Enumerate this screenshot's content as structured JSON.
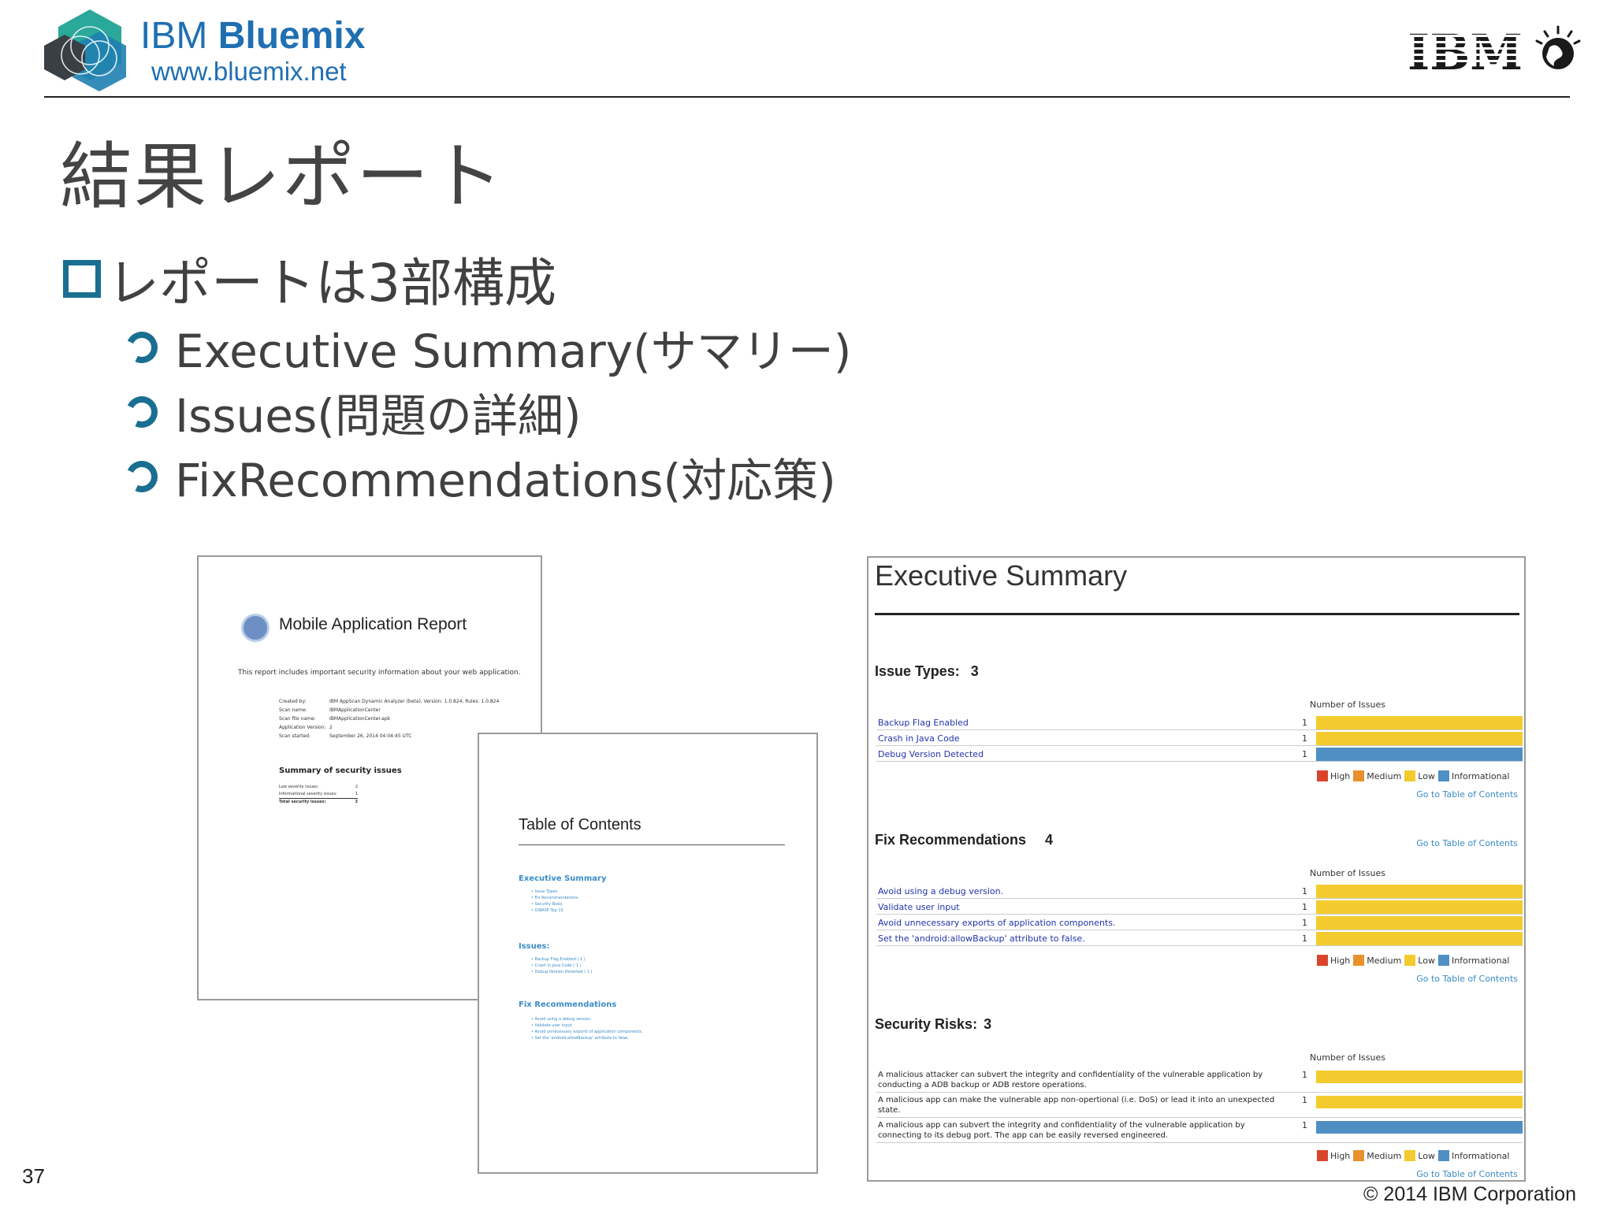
{
  "header": {
    "brand_prefix": "IBM",
    "brand_name": "Bluemix",
    "brand_url": "www.bluemix.net",
    "corp_logo": "IBM"
  },
  "slide": {
    "title": "結果レポート",
    "main_bullet": "レポートは3部構成",
    "sub_bullets": [
      "Executive Summary(サマリー)",
      "Issues(問題の詳細)",
      "FixRecommendations(対応策)"
    ]
  },
  "report_cover": {
    "title": "Mobile Application Report",
    "intro": "This report includes important security information about your web application.",
    "meta": [
      {
        "k": "Created by:",
        "v": "IBM AppScan Dynamic Analyzer (beta), Version: 1.0.824,  Rules: 1.0.824"
      },
      {
        "k": "Scan name:",
        "v": "IBMApplicationCenter"
      },
      {
        "k": "Scan file name:",
        "v": "IBMApplicationCenter.apk"
      },
      {
        "k": "Application Version:",
        "v": "2"
      },
      {
        "k": "Scan started:",
        "v": "September 26, 2014 04:04:45 UTC"
      }
    ],
    "summary_heading": "Summary of security issues",
    "summary": [
      {
        "k": "Low severity issues:",
        "v": "2"
      },
      {
        "k": "Informational severity issues:",
        "v": "1"
      },
      {
        "k": "Total security issues:",
        "v": "3"
      }
    ]
  },
  "toc": {
    "title": "Table of Contents",
    "sections": [
      {
        "heading": "Executive Summary",
        "items": [
          "Issue Types",
          "Fix Recommendations",
          "Security Risks",
          "OWASP Top 10"
        ]
      },
      {
        "heading": "Issues:",
        "items": [
          "Backup Flag Enabled  ( 1 )",
          "Crash in Java Code  ( 1 )",
          "Debug Version Detected  ( 1 )"
        ]
      },
      {
        "heading": "Fix Recommendations",
        "items": [
          "Avoid using a debug version.",
          "Validate user input",
          "Avoid unnecessary exports of application components.",
          "Set the 'android:allowBackup' attribute to false."
        ]
      }
    ]
  },
  "executive_summary": {
    "title": "Executive Summary",
    "number_of_issues_label": "Number of Issues",
    "goto_label": "Go to Table of Contents",
    "legend": [
      {
        "label": "High",
        "color": "#d9452b"
      },
      {
        "label": "Medium",
        "color": "#e8912c"
      },
      {
        "label": "Low",
        "color": "#f3cb2e"
      },
      {
        "label": "Informational",
        "color": "#4f8fc4"
      }
    ],
    "issue_types": {
      "heading": "Issue Types:",
      "count": "3",
      "rows": [
        {
          "label": "Backup Flag Enabled",
          "num": "1",
          "color": "#f3cb2e"
        },
        {
          "label": "Crash in Java Code",
          "num": "1",
          "color": "#f3cb2e"
        },
        {
          "label": "Debug Version Detected",
          "num": "1",
          "color": "#4f8fc4"
        }
      ]
    },
    "fix_recommendations": {
      "heading": "Fix Recommendations",
      "count": "4",
      "rows": [
        {
          "label": "Avoid using a debug version.",
          "num": "1",
          "color": "#f3cb2e"
        },
        {
          "label": "Validate user input",
          "num": "1",
          "color": "#f3cb2e"
        },
        {
          "label": "Avoid unnecessary exports of application components.",
          "num": "1",
          "color": "#f3cb2e"
        },
        {
          "label": "Set the 'android:allowBackup' attribute to false.",
          "num": "1",
          "color": "#f3cb2e"
        }
      ]
    },
    "security_risks": {
      "heading": "Security Risks:",
      "count": "3",
      "rows": [
        {
          "label": "A malicious attacker can subvert the integrity and confidentiality of the vulnerable application by conducting a ADB backup or ADB restore operations.",
          "num": "1",
          "color": "#f3cb2e"
        },
        {
          "label": "A malicious app can make the vulnerable app non-opertional (i.e. DoS) or lead it into an unexpected state.",
          "num": "1",
          "color": "#f3cb2e"
        },
        {
          "label": "A malicious app can subvert the integrity and confidentiality of the vulnerable application by connecting to its debug port. The app can be easily reversed engineered.",
          "num": "1",
          "color": "#4f8fc4"
        }
      ]
    }
  },
  "footer": {
    "page_number": "37",
    "copyright": "© 2014 IBM Corporation"
  }
}
